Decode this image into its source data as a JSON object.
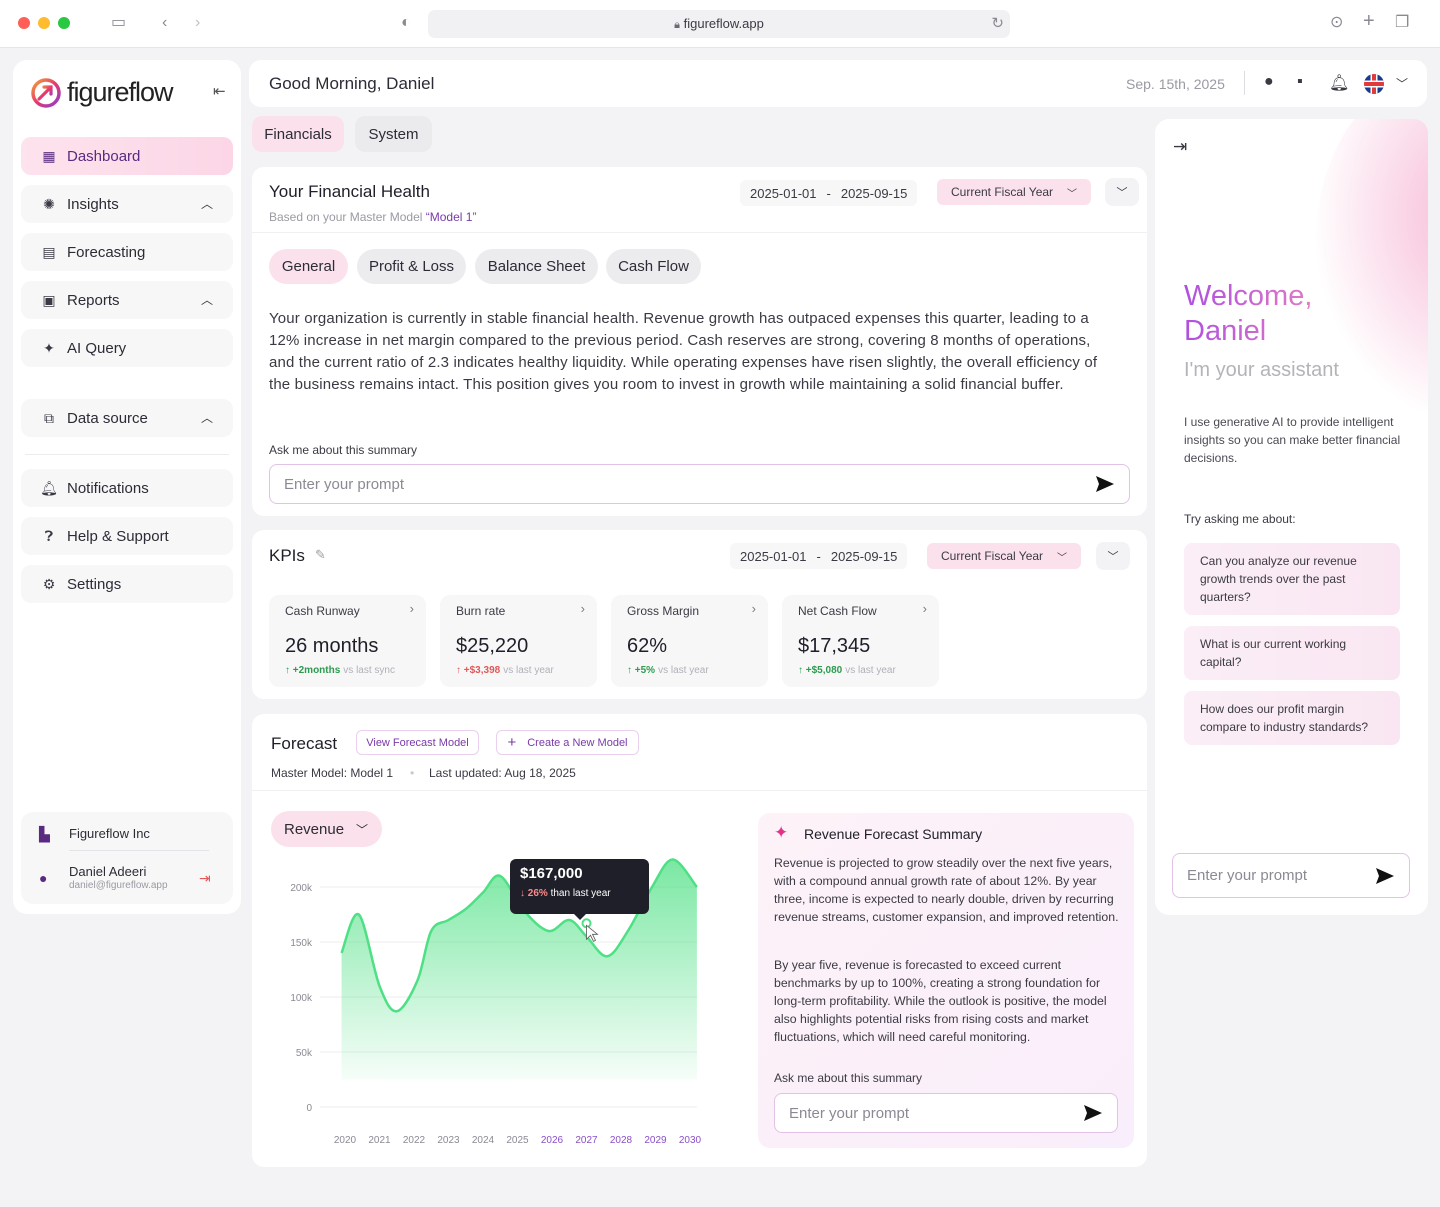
{
  "browser": {
    "url": "figureflow.app"
  },
  "brand": {
    "name": "figureflow"
  },
  "sidebar": {
    "items": [
      {
        "label": "Dashboard"
      },
      {
        "label": "Insights"
      },
      {
        "label": "Forecasting"
      },
      {
        "label": "Reports"
      },
      {
        "label": "AI Query"
      },
      {
        "label": "Data source"
      },
      {
        "label": "Notifications"
      },
      {
        "label": "Help & Support"
      },
      {
        "label": "Settings"
      }
    ],
    "org": "Figureflow Inc",
    "user_name": "Daniel Adeeri",
    "user_email": "daniel@figureflow.app"
  },
  "header": {
    "greeting": "Good Morning, Daniel",
    "date": "Sep. 15th, 2025"
  },
  "top_tabs": [
    "Financials",
    "System"
  ],
  "health": {
    "title": "Your Financial Health",
    "subtitle_prefix": "Based on your Master Model ",
    "model": "“Model 1”",
    "date_from": "2025-01-01",
    "date_sep": "-",
    "date_to": "2025-09-15",
    "period": "Current Fiscal Year",
    "tabs": [
      "General",
      "Profit & Loss",
      "Balance Sheet",
      "Cash Flow"
    ],
    "summary": "Your organization is currently in stable financial health. Revenue growth has outpaced expenses this quarter, leading to a 12% increase in net margin compared to the previous period. Cash reserves are strong, covering 8 months of operations, and the current ratio of 2.3 indicates healthy liquidity. While operating expenses have risen slightly, the overall efficiency of the business remains intact. This position gives you room to invest in growth while maintaining a solid financial buffer.",
    "ask_label": "Ask me about this summary",
    "prompt_placeholder": "Enter your prompt"
  },
  "kpis": {
    "title": "KPIs",
    "date_from": "2025-01-01",
    "date_sep": "-",
    "date_to": "2025-09-15",
    "period": "Current Fiscal Year",
    "cards": [
      {
        "label": "Cash Runway",
        "value": "26 months",
        "delta": "+2months",
        "direction": "up",
        "vs": "vs last sync"
      },
      {
        "label": "Burn rate",
        "value": "$25,220",
        "delta": "+$3,398",
        "direction": "down",
        "vs": "vs last year"
      },
      {
        "label": "Gross Margin",
        "value": "62%",
        "delta": "+5%",
        "direction": "up",
        "vs": "vs last year"
      },
      {
        "label": "Net Cash Flow",
        "value": "$17,345",
        "delta": "+$5,080",
        "direction": "up",
        "vs": "vs last year"
      }
    ]
  },
  "forecast": {
    "title": "Forecast",
    "view_btn": "View Forecast Model",
    "create_btn": "Create a New Model",
    "master_model": "Master Model: Model 1",
    "last_updated": "Last updated: Aug 18, 2025",
    "metric": "Revenue",
    "tooltip_value": "$167,000",
    "tooltip_pct": "26%",
    "tooltip_text": "than last year",
    "summary_title": "Revenue Forecast Summary",
    "summary_p1": "Revenue is projected to grow steadily over the next five years, with a compound annual growth rate of about 12%. By year three, income is expected to nearly double, driven by recurring revenue streams, customer expansion, and improved retention.",
    "summary_p2": "By year five, revenue is forecasted to exceed current benchmarks by up to 100%, creating a strong foundation for long-term profitability. While the outlook is positive, the model also highlights potential risks from rising costs and market fluctuations, which will need careful monitoring.",
    "ask_label": "Ask me about this summary",
    "prompt_placeholder": "Enter your prompt"
  },
  "chart_data": {
    "type": "area",
    "y_tick_labels": [
      "200k",
      "150k",
      "100k",
      "50k",
      "0"
    ],
    "y_ticks": [
      200000,
      150000,
      100000,
      50000,
      0
    ],
    "ylim": [
      0,
      200000
    ],
    "x_labels": [
      "2020",
      "2021",
      "2022",
      "2023",
      "2024",
      "2025",
      "2026",
      "2027",
      "2028",
      "2029",
      "2030"
    ],
    "forecast_start_index": 6,
    "series": [
      {
        "x": [
          2019.9,
          2020.4,
          2021.0,
          2021.5,
          2022.1,
          2022.5,
          2023.0,
          2023.5,
          2024.0,
          2024.5,
          2025.2,
          2025.9,
          2026.5,
          2027.0,
          2027.6,
          2028.2,
          2028.9,
          2029.5,
          2030.2
        ],
        "y": [
          140000,
          175000,
          110000,
          87000,
          115000,
          160000,
          170000,
          180000,
          195000,
          210000,
          178000,
          160000,
          170000,
          155000,
          137000,
          160000,
          200000,
          225000,
          200000
        ]
      }
    ],
    "highlight": {
      "x": 2027.0,
      "y": 167000
    },
    "accent_color": "#4ee084",
    "forecast_label_color": "#8a4fc8"
  },
  "assistant": {
    "welcome": "Welcome,",
    "name": "Daniel",
    "subtitle": "I'm your assistant",
    "desc": "I use generative AI to provide intelligent insights so you can make better financial decisions.",
    "try_label": "Try asking me about:",
    "suggestions": [
      "Can you analyze our revenue growth trends over the past quarters?",
      "What is our current working capital?",
      "How does our profit margin compare to industry standards?"
    ],
    "prompt_placeholder": "Enter your prompt"
  }
}
